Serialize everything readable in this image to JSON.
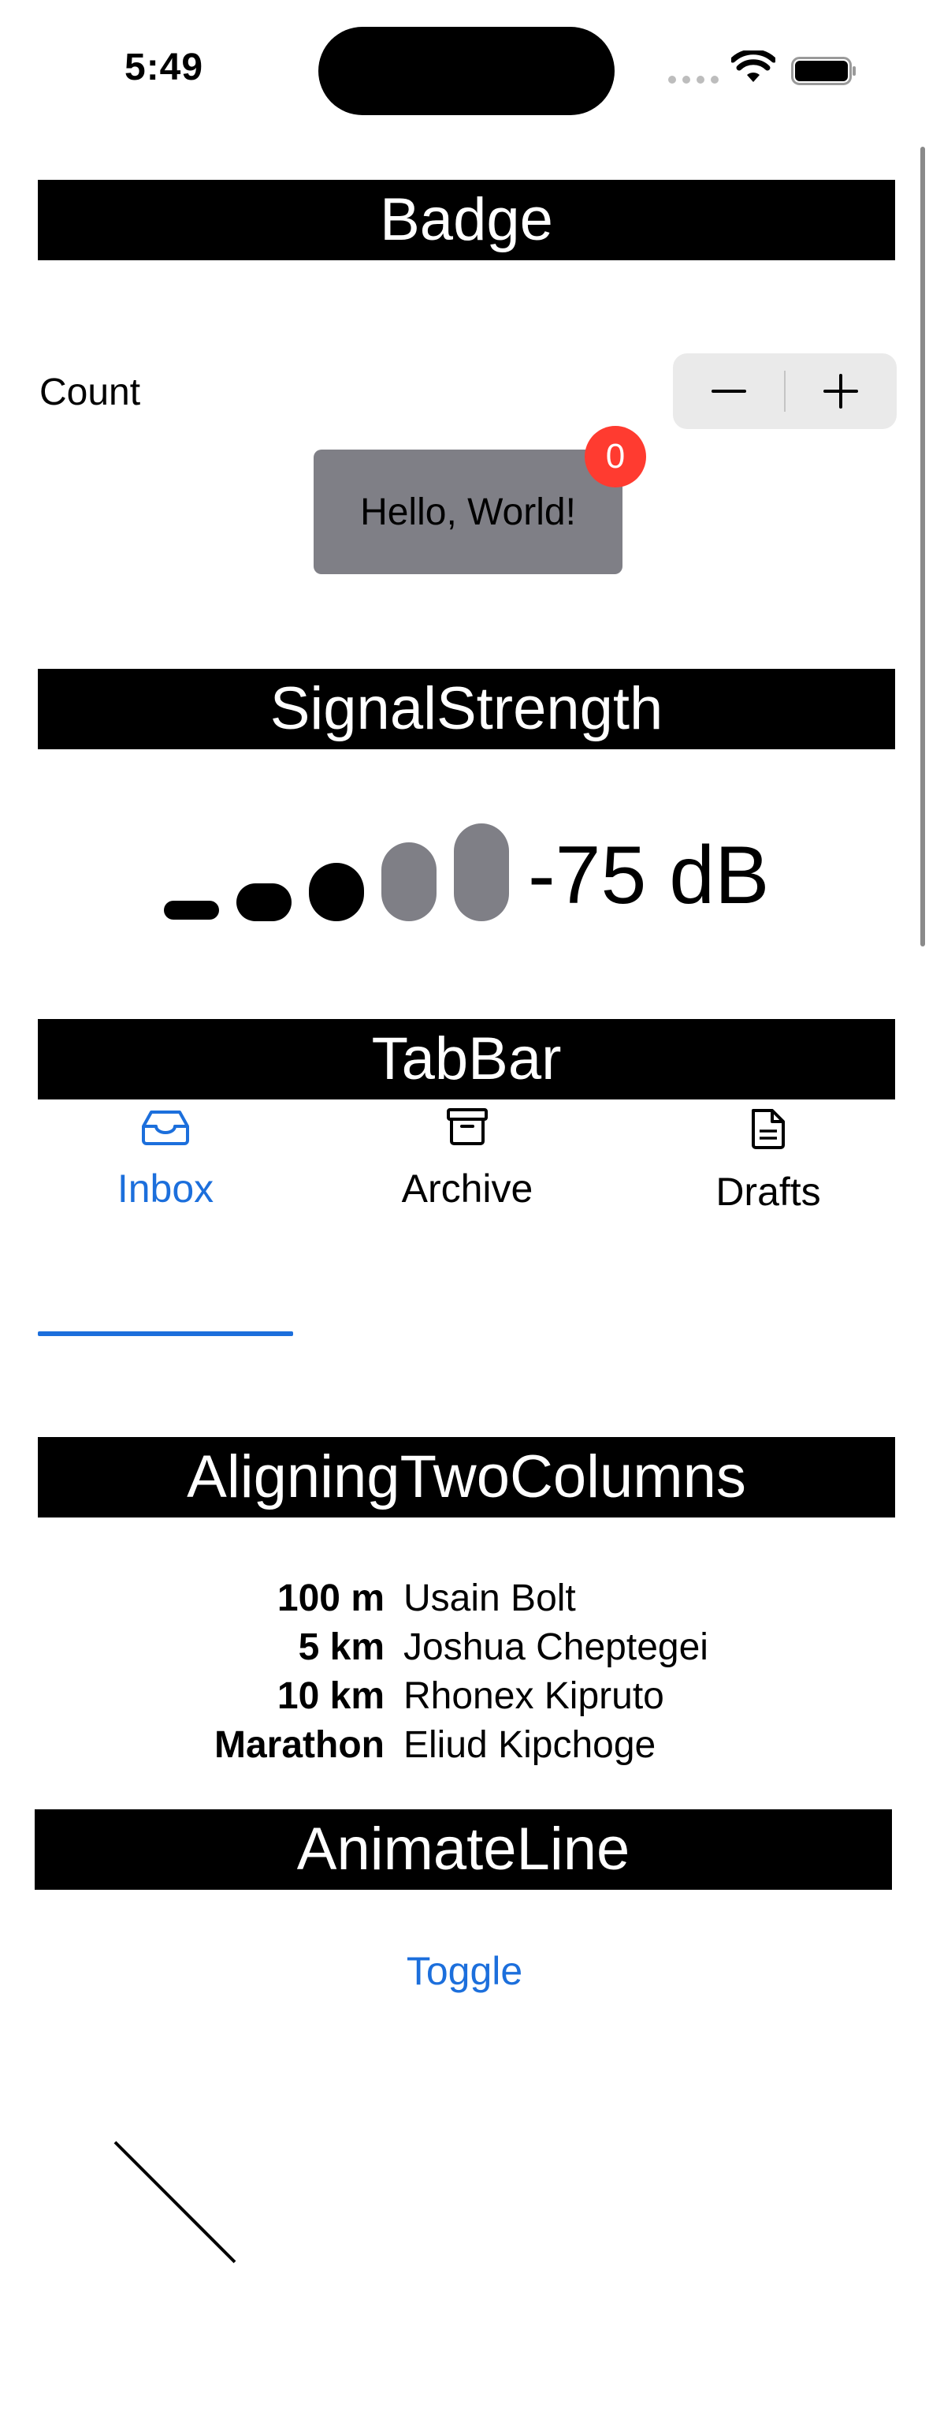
{
  "status_bar": {
    "time": "5:49"
  },
  "badge_section": {
    "header": "Badge",
    "count_label": "Count",
    "stepper": {
      "minus": "−",
      "plus": "+"
    },
    "hello_text": "Hello, World!",
    "badge_value": "0"
  },
  "signal_section": {
    "header": "SignalStrength",
    "active_bars": 3,
    "total_bars": 5,
    "value_text": "-75 dB"
  },
  "tabbar_section": {
    "header": "TabBar",
    "tabs": [
      {
        "label": "Inbox",
        "icon": "inbox-icon",
        "selected": true
      },
      {
        "label": "Archive",
        "icon": "archive-icon",
        "selected": false
      },
      {
        "label": "Drafts",
        "icon": "document-icon",
        "selected": false
      }
    ]
  },
  "columns_section": {
    "header": "AligningTwoColumns",
    "rows": [
      {
        "distance": "100 m",
        "name": "Usain Bolt"
      },
      {
        "distance": "5 km",
        "name": "Joshua Cheptegei"
      },
      {
        "distance": "10 km",
        "name": "Rhonex Kipruto"
      },
      {
        "distance": "Marathon",
        "name": "Eliud Kipchoge"
      }
    ]
  },
  "animate_section": {
    "header": "AnimateLine",
    "toggle_label": "Toggle"
  },
  "colors": {
    "accent": "#1c6fdc",
    "badge": "#ff3b30",
    "inactive": "#7f7f86"
  }
}
